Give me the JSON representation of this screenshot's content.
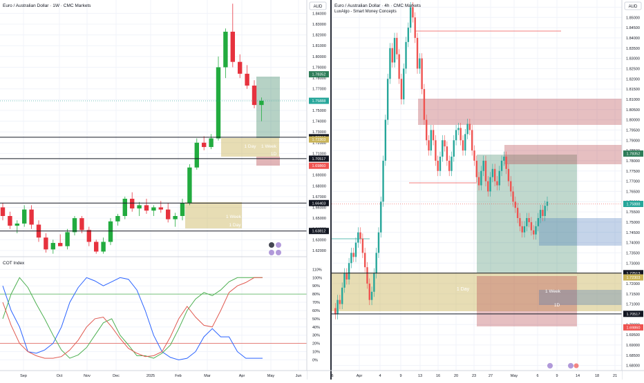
{
  "colors": {
    "up": "#26a69a",
    "upBright": "#22ab3f",
    "down": "#ef5350",
    "downBright": "#e6323e",
    "grid": "#f0f3fa",
    "axisText": "#131722",
    "cotBlue": "#2962ff",
    "cotGreen": "#4caf50",
    "cotRed": "#e0584f",
    "zoneYellow": "#c9b458",
    "zoneGreen": "#2e7d59",
    "zoneRed": "#b7474c",
    "zoneBlue": "#3f6fb5"
  },
  "left_chart": {
    "title": "Euro / Australian Dollar · 1W · CMC Markets",
    "currency_badge": "AUD",
    "price_ticks": [
      "1.84000",
      "1.83000",
      "1.82000",
      "1.81000",
      "1.80000",
      "1.79000",
      "1.78000",
      "1.77000",
      "1.76000",
      "1.75000",
      "1.74000",
      "1.73000",
      "1.72000",
      "1.71000",
      "1.70000",
      "1.69000",
      "1.68000",
      "1.67000",
      "1.66000",
      "1.65000",
      "1.64000",
      "1.63000",
      "1.62000"
    ],
    "price_tick_values": [
      1.84,
      1.83,
      1.82,
      1.81,
      1.8,
      1.79,
      1.78,
      1.77,
      1.76,
      1.75,
      1.74,
      1.73,
      1.72,
      1.71,
      1.7,
      1.69,
      1.68,
      1.67,
      1.66,
      1.65,
      1.64,
      1.63,
      1.62
    ],
    "price_range": [
      1.6155,
      1.8505
    ],
    "price_labels": [
      {
        "text": "1.78352",
        "value": 1.7835,
        "color": "#2e7d59"
      },
      {
        "text": "1.75888",
        "value": 1.7589,
        "color": "#26a69a"
      },
      {
        "text": "1.72513",
        "value": 1.7251,
        "color": "#131722"
      },
      {
        "text": "1.72303",
        "value": 1.723,
        "color": "#c9b458"
      },
      {
        "text": "1.70517",
        "value": 1.7052,
        "color": "#131722"
      },
      {
        "text": "1.69860",
        "value": 1.6986,
        "color": "#ef5350"
      },
      {
        "text": "1.66403",
        "value": 1.664,
        "color": "#131722"
      },
      {
        "text": "1.63812",
        "value": 1.6381,
        "color": "#131722"
      }
    ],
    "date_ticks": [
      "Sep",
      "Oct",
      "Nov",
      "Dec",
      "2025",
      "Feb",
      "Mar",
      "Apr",
      "May",
      "Jun"
    ],
    "zone_labels": {
      "d1": "1 Day",
      "w1": "1 Week",
      "d1b": "1D",
      "w1b": "1 Week",
      "d1c": "1 Day"
    },
    "cot": {
      "title": "COT Index",
      "pct_ticks": [
        "110%",
        "100%",
        "90%",
        "80%",
        "70%",
        "60%",
        "50%",
        "40%",
        "30%",
        "20%",
        "10%",
        "0%"
      ],
      "pct_values": [
        110,
        100,
        90,
        80,
        70,
        60,
        50,
        40,
        30,
        20,
        10,
        0
      ],
      "range": [
        -8,
        112
      ],
      "reference_levels": [
        80,
        20
      ],
      "series": [
        {
          "color_key": "cotBlue",
          "values": [
            90,
            60,
            40,
            10,
            8,
            12,
            20,
            40,
            70,
            88,
            100,
            96,
            90,
            95,
            100,
            98,
            85,
            60,
            30,
            10,
            3,
            0,
            2,
            10,
            28,
            38,
            28,
            28,
            10,
            2,
            2,
            2
          ]
        },
        {
          "color_key": "cotGreen",
          "values": [
            50,
            80,
            100,
            88,
            68,
            50,
            30,
            12,
            2,
            6,
            15,
            30,
            45,
            50,
            30,
            18,
            5,
            5,
            2,
            8,
            18,
            38,
            60,
            74,
            82,
            78,
            85,
            95,
            100,
            100,
            100,
            100
          ]
        },
        {
          "color_key": "cotRed",
          "values": [
            70,
            42,
            20,
            10,
            5,
            2,
            2,
            4,
            12,
            24,
            40,
            50,
            52,
            40,
            26,
            14,
            8,
            4,
            5,
            10,
            28,
            50,
            65,
            52,
            42,
            40,
            60,
            82,
            90,
            94,
            100,
            100
          ]
        }
      ]
    }
  },
  "right_chart": {
    "title": "Euro / Australian Dollar · 4h · CMC Markets",
    "subtitle": "LuxAlgo - Smart Money Concepts",
    "currency_badge": "AUD",
    "price_ticks": [
      "1.85500",
      "1.85000",
      "1.84500",
      "1.84000",
      "1.83500",
      "1.83000",
      "1.82500",
      "1.82000",
      "1.81500",
      "1.81000",
      "1.80500",
      "1.80000",
      "1.79500",
      "1.79000",
      "1.78500",
      "1.78000",
      "1.77500",
      "1.77000",
      "1.76500",
      "1.76000",
      "1.75500",
      "1.75000",
      "1.74500",
      "1.74000",
      "1.73500",
      "1.73000",
      "1.72500",
      "1.72000",
      "1.71500",
      "1.71000",
      "1.70500",
      "1.70000",
      "1.69500",
      "1.69000",
      "1.68500",
      "1.68000"
    ],
    "price_tick_values": [
      1.855,
      1.85,
      1.845,
      1.84,
      1.835,
      1.83,
      1.825,
      1.82,
      1.815,
      1.81,
      1.805,
      1.8,
      1.795,
      1.79,
      1.785,
      1.78,
      1.775,
      1.77,
      1.765,
      1.76,
      1.755,
      1.75,
      1.745,
      1.74,
      1.735,
      1.73,
      1.725,
      1.72,
      1.715,
      1.71,
      1.705,
      1.7,
      1.695,
      1.69,
      1.685,
      1.68
    ],
    "price_range": [
      1.6775,
      1.8575
    ],
    "price_labels": [
      {
        "text": "1.78352",
        "value": 1.7835,
        "color": "#2e7d59"
      },
      {
        "text": "1.75888",
        "value": 1.7589,
        "color": "#26a69a"
      },
      {
        "text": "1.72513",
        "value": 1.7251,
        "color": "#131722"
      },
      {
        "text": "1.72303",
        "value": 1.723,
        "color": "#c9b458"
      },
      {
        "text": "1.70517",
        "value": 1.7052,
        "color": "#131722"
      },
      {
        "text": "1.69860",
        "value": 1.6986,
        "color": "#ef5350"
      }
    ],
    "date_ticks": [
      "6",
      "Apr",
      "4",
      "9",
      "13",
      "16",
      "20",
      "23",
      "27",
      "May",
      "6",
      "9",
      "14",
      "18",
      "21"
    ],
    "zone_labels": {
      "d1": "1 Day",
      "w1": "1 Week",
      "d1b": "1D"
    }
  }
}
